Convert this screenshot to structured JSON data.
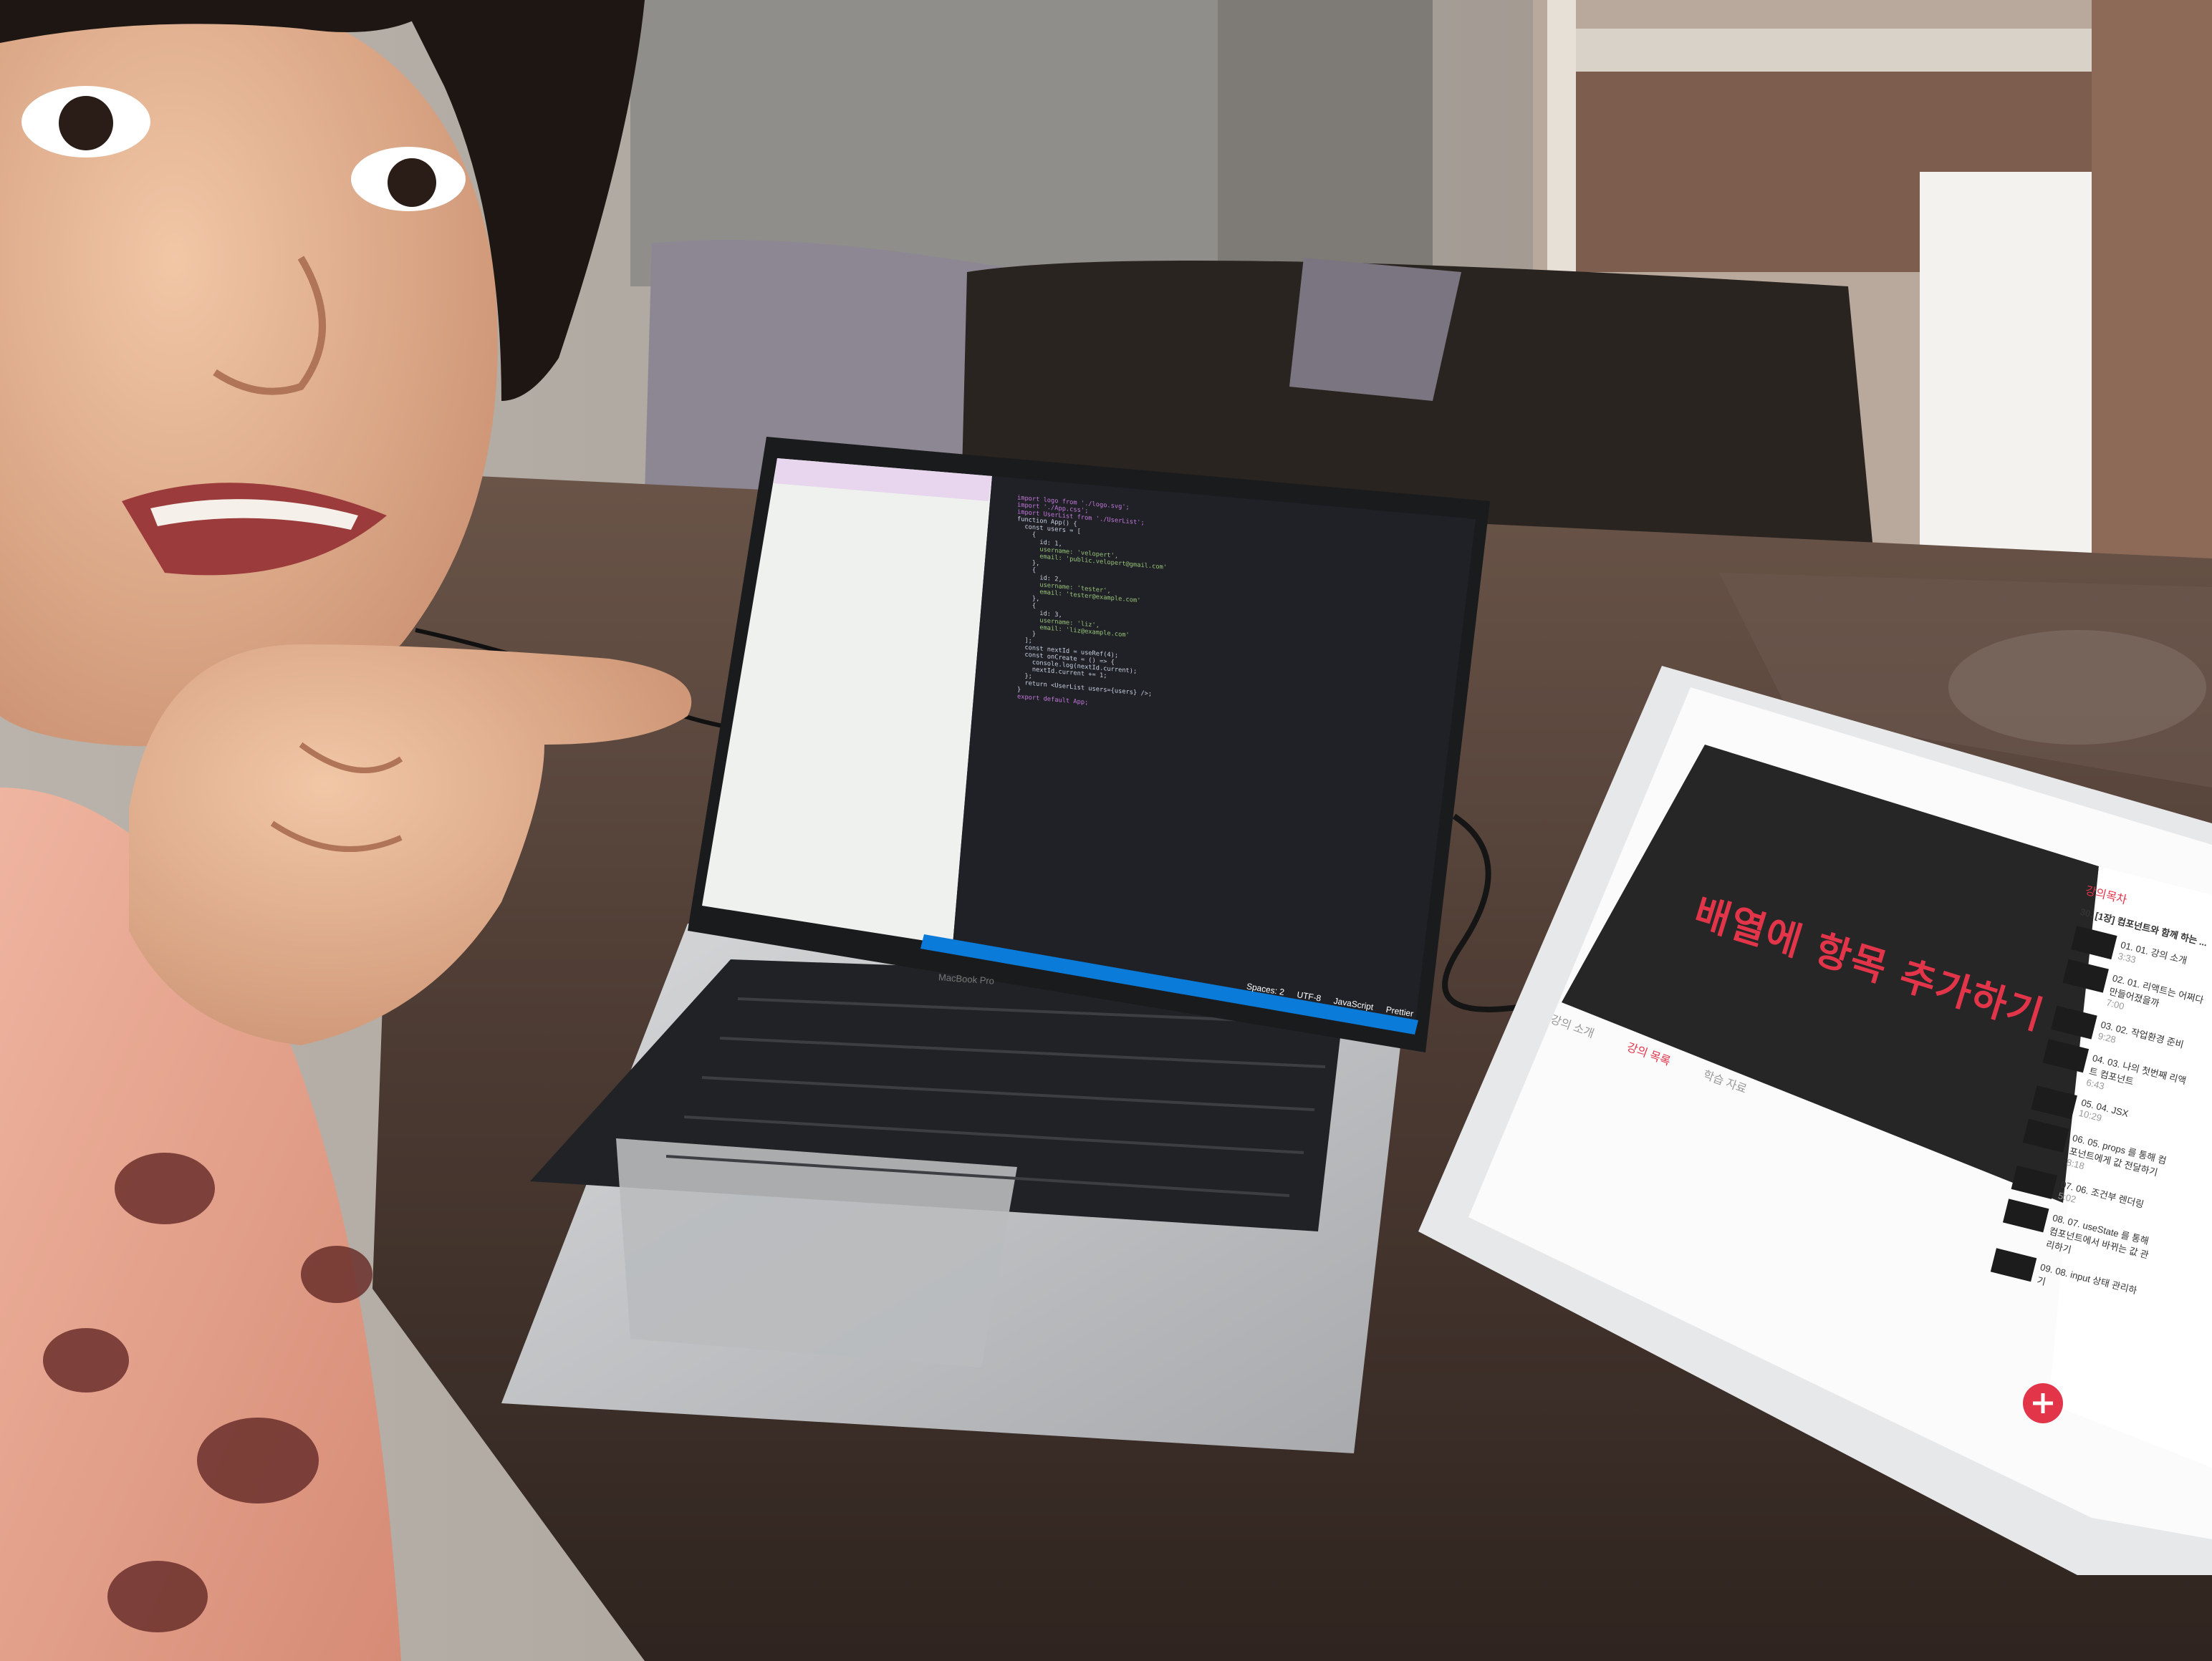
{
  "image": {
    "colors": {
      "wall": "#cfc7bc",
      "table": "#4a3b33",
      "sweater": "#e6a792",
      "sweater_pattern": "#6b2f2c",
      "skin": "#e9b896",
      "hair": "#1d1612",
      "laptop_body": "#c7c9cc",
      "editor_bg": "#1f2126",
      "status_bar": "#0a7bd8",
      "ipad_frame": "#f2f2f2",
      "video_bg": "#222222",
      "accent_red": "#e3354a"
    }
  },
  "laptop": {
    "brand": "MacBook Pro",
    "status_bar_items": [
      "Prettier",
      "JavaScript",
      "UTF-8",
      "Spaces: 2"
    ],
    "code": {
      "lines": [
        "import logo from './logo.svg';",
        "import './App.css';",
        "import UserList from './UserList';",
        "",
        "function App() {",
        "  const users = [",
        "    {",
        "      id: 1,",
        "      username: 'velopert',",
        "      email: 'public.velopert@gmail.com'",
        "    },",
        "    {",
        "      id: 2,",
        "      username: 'tester',",
        "      email: 'tester@example.com'",
        "    },",
        "    {",
        "      id: 3,",
        "      username: 'liz',",
        "      email: 'liz@example.com'",
        "    }",
        "  ];",
        "",
        "  const nextId = useRef(4);",
        "  const onCreate = () => {",
        "    console.log(nextId.current);",
        "    nextId.current += 1;",
        "  };",
        "  return <UserList users={users} />;",
        "}",
        "",
        "export default App;"
      ]
    }
  },
  "tablet": {
    "video_title_overlay": "배열에 항목 추가하기",
    "sidebar_heading": "강의목차",
    "section_title": "30. [1장] 컴포넌트와 함께 하는 ...",
    "lessons": [
      {
        "title": "01. 01. 강의 소개",
        "duration": "3:33"
      },
      {
        "title": "02. 01. 리액트는 어쩌다 만들어졌을까",
        "duration": "7:00"
      },
      {
        "title": "03. 02. 작업환경 준비",
        "duration": "9:28"
      },
      {
        "title": "04. 03. 나의 첫번째 리액트 컴포넌트",
        "duration": "6:43"
      },
      {
        "title": "05. 04. JSX",
        "duration": "10:29"
      },
      {
        "title": "06. 05. props 를 통해 컴포넌트에게 값 전달하기",
        "duration": "8:18"
      },
      {
        "title": "07. 06. 조건부 렌더링",
        "duration": "5:02"
      },
      {
        "title": "08. 07. useState 를 통해 컴포넌트에서 바뀌는 값 관리하기",
        "duration": ""
      },
      {
        "title": "09. 08. input 상태 관리하기",
        "duration": ""
      }
    ],
    "tabs": [
      "강의 소개",
      "강의 목록",
      "학습 자료"
    ],
    "active_tab": 1
  }
}
